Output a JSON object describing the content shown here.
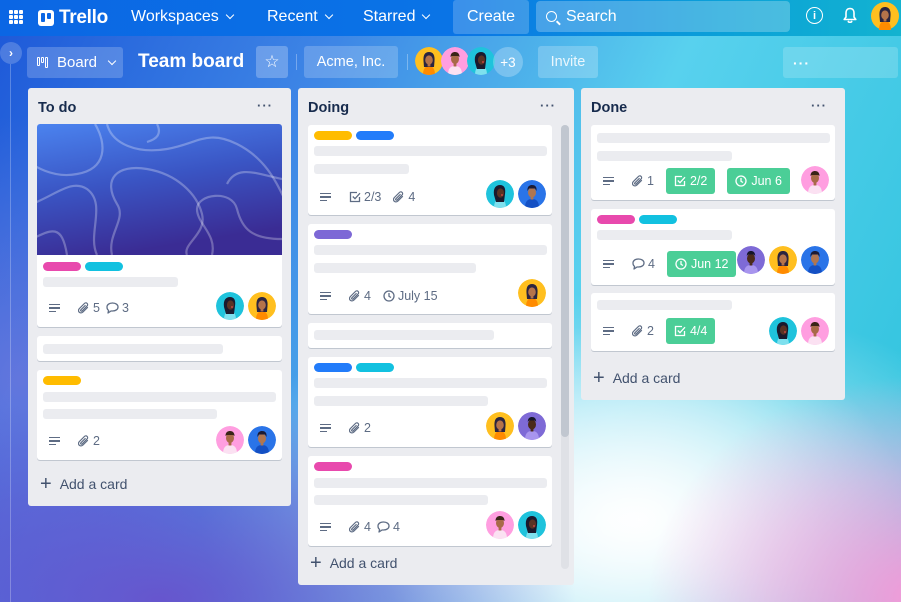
{
  "topnav": {
    "logo": "Trello",
    "menus": [
      {
        "label": "Workspaces"
      },
      {
        "label": "Recent"
      },
      {
        "label": "Starred"
      }
    ],
    "create_label": "Create",
    "search_placeholder": "Search"
  },
  "board_header": {
    "view_label": "Board",
    "title": "Team board",
    "workspace_label": "Acme, Inc.",
    "more_members": "+3",
    "invite_label": "Invite",
    "menu_label": "···"
  },
  "colors": {
    "label_pink": "#e849ad",
    "label_cyan": "#12c1e0",
    "label_yellow": "#ffbc00",
    "label_blue": "#227cfa",
    "label_purple": "#7d68d6",
    "badge_green": "#4bce97",
    "list_bg": "#ebecf0"
  },
  "lists": [
    {
      "title": "To do",
      "more": "···",
      "add_label": "Add a card",
      "cards": [
        {
          "cover": true,
          "labels": [
            "pink",
            "cyan"
          ],
          "attachments": "5",
          "comments": "3",
          "members": [
            "teal-woman",
            "yellow-woman"
          ]
        },
        {
          "labels": []
        },
        {
          "labels": [
            "yellow"
          ],
          "attachments": "2",
          "members": [
            "pink-man",
            "blue-man"
          ]
        }
      ]
    },
    {
      "title": "Doing",
      "more": "···",
      "add_label": "Add a card",
      "cards": [
        {
          "labels": [
            "yellow",
            "blue"
          ],
          "checklist": "2/3",
          "attachments": "4",
          "members": [
            "teal-woman",
            "blue-man"
          ]
        },
        {
          "labels": [
            "purple"
          ],
          "attachments": "4",
          "due": "July 15",
          "members": [
            "yellow-woman"
          ]
        },
        {
          "labels": []
        },
        {
          "labels": [
            "blue",
            "cyan"
          ],
          "attachments": "2",
          "members": [
            "yellow-woman",
            "purple-man"
          ]
        },
        {
          "labels": [
            "pink"
          ],
          "attachments": "4",
          "comments": "4",
          "members": [
            "pink-man",
            "teal-woman"
          ]
        }
      ]
    },
    {
      "title": "Done",
      "more": "···",
      "add_label": "Add a card",
      "cards": [
        {
          "attachments": "1",
          "checklist": "2/2",
          "due": "Jun 6",
          "members": [
            "pink-man"
          ]
        },
        {
          "labels": [
            "pink",
            "cyan"
          ],
          "comments": "4",
          "due": "Jun 12",
          "members": [
            "purple-man",
            "yellow-woman",
            "blue-man"
          ]
        },
        {
          "attachments": "2",
          "checklist": "4/4",
          "members": [
            "teal-woman",
            "pink-man"
          ]
        }
      ]
    }
  ]
}
